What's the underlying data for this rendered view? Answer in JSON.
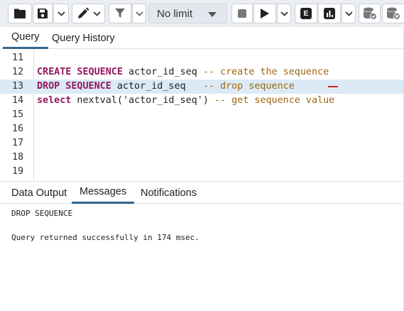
{
  "toolbar": {
    "limit_label": "No limit",
    "icons": [
      "folder-icon",
      "save-icon",
      "chevron-down-icon",
      "pen-icon",
      "chevron-down-icon",
      "filter-icon",
      "chevron-down-icon",
      "chevron-down-icon",
      "stop-icon",
      "play-icon",
      "chevron-down-icon",
      "explain-icon",
      "explain-analyze-icon",
      "chevron-down-icon",
      "commit-icon",
      "rollback-icon"
    ],
    "explain_letter": "E"
  },
  "query_tabs": [
    {
      "label": "Query",
      "active": true
    },
    {
      "label": "Query History",
      "active": false
    }
  ],
  "editor": {
    "lines": [
      {
        "num": "11",
        "tokens": []
      },
      {
        "num": "12",
        "tokens": [
          {
            "t": "kw",
            "v": "CREATE SEQUENCE"
          },
          {
            "t": "tx",
            "v": " actor_id_seq "
          },
          {
            "t": "cm",
            "v": "-- create the sequence"
          }
        ]
      },
      {
        "num": "13",
        "tokens": [
          {
            "t": "kw",
            "v": "DROP SEQUENCE"
          },
          {
            "t": "tx",
            "v": " actor_id_seq   "
          },
          {
            "t": "cm",
            "v": "-- drop sequence"
          }
        ],
        "active": true
      },
      {
        "num": "14",
        "tokens": [
          {
            "t": "kw",
            "v": "select"
          },
          {
            "t": "tx",
            "v": " nextval("
          },
          {
            "t": "str",
            "v": "'actor_id_seq'"
          },
          {
            "t": "tx",
            "v": ") "
          },
          {
            "t": "cm",
            "v": "-- get sequence value"
          }
        ]
      },
      {
        "num": "15",
        "tokens": []
      },
      {
        "num": "16",
        "tokens": []
      },
      {
        "num": "17",
        "tokens": []
      },
      {
        "num": "18",
        "tokens": []
      },
      {
        "num": "19",
        "tokens": []
      }
    ]
  },
  "result_tabs": [
    {
      "label": "Data Output",
      "active": false
    },
    {
      "label": "Messages",
      "active": true
    },
    {
      "label": "Notifications",
      "active": false
    }
  ],
  "messages": {
    "line1": "DROP SEQUENCE",
    "line2": "Query returned successfully in 174 msec."
  },
  "colors": {
    "keyword": "#93195f",
    "comment": "#a0670f",
    "active_line": "#dbeaf6",
    "tab_underline": "#326690",
    "marker": "#d42020"
  }
}
